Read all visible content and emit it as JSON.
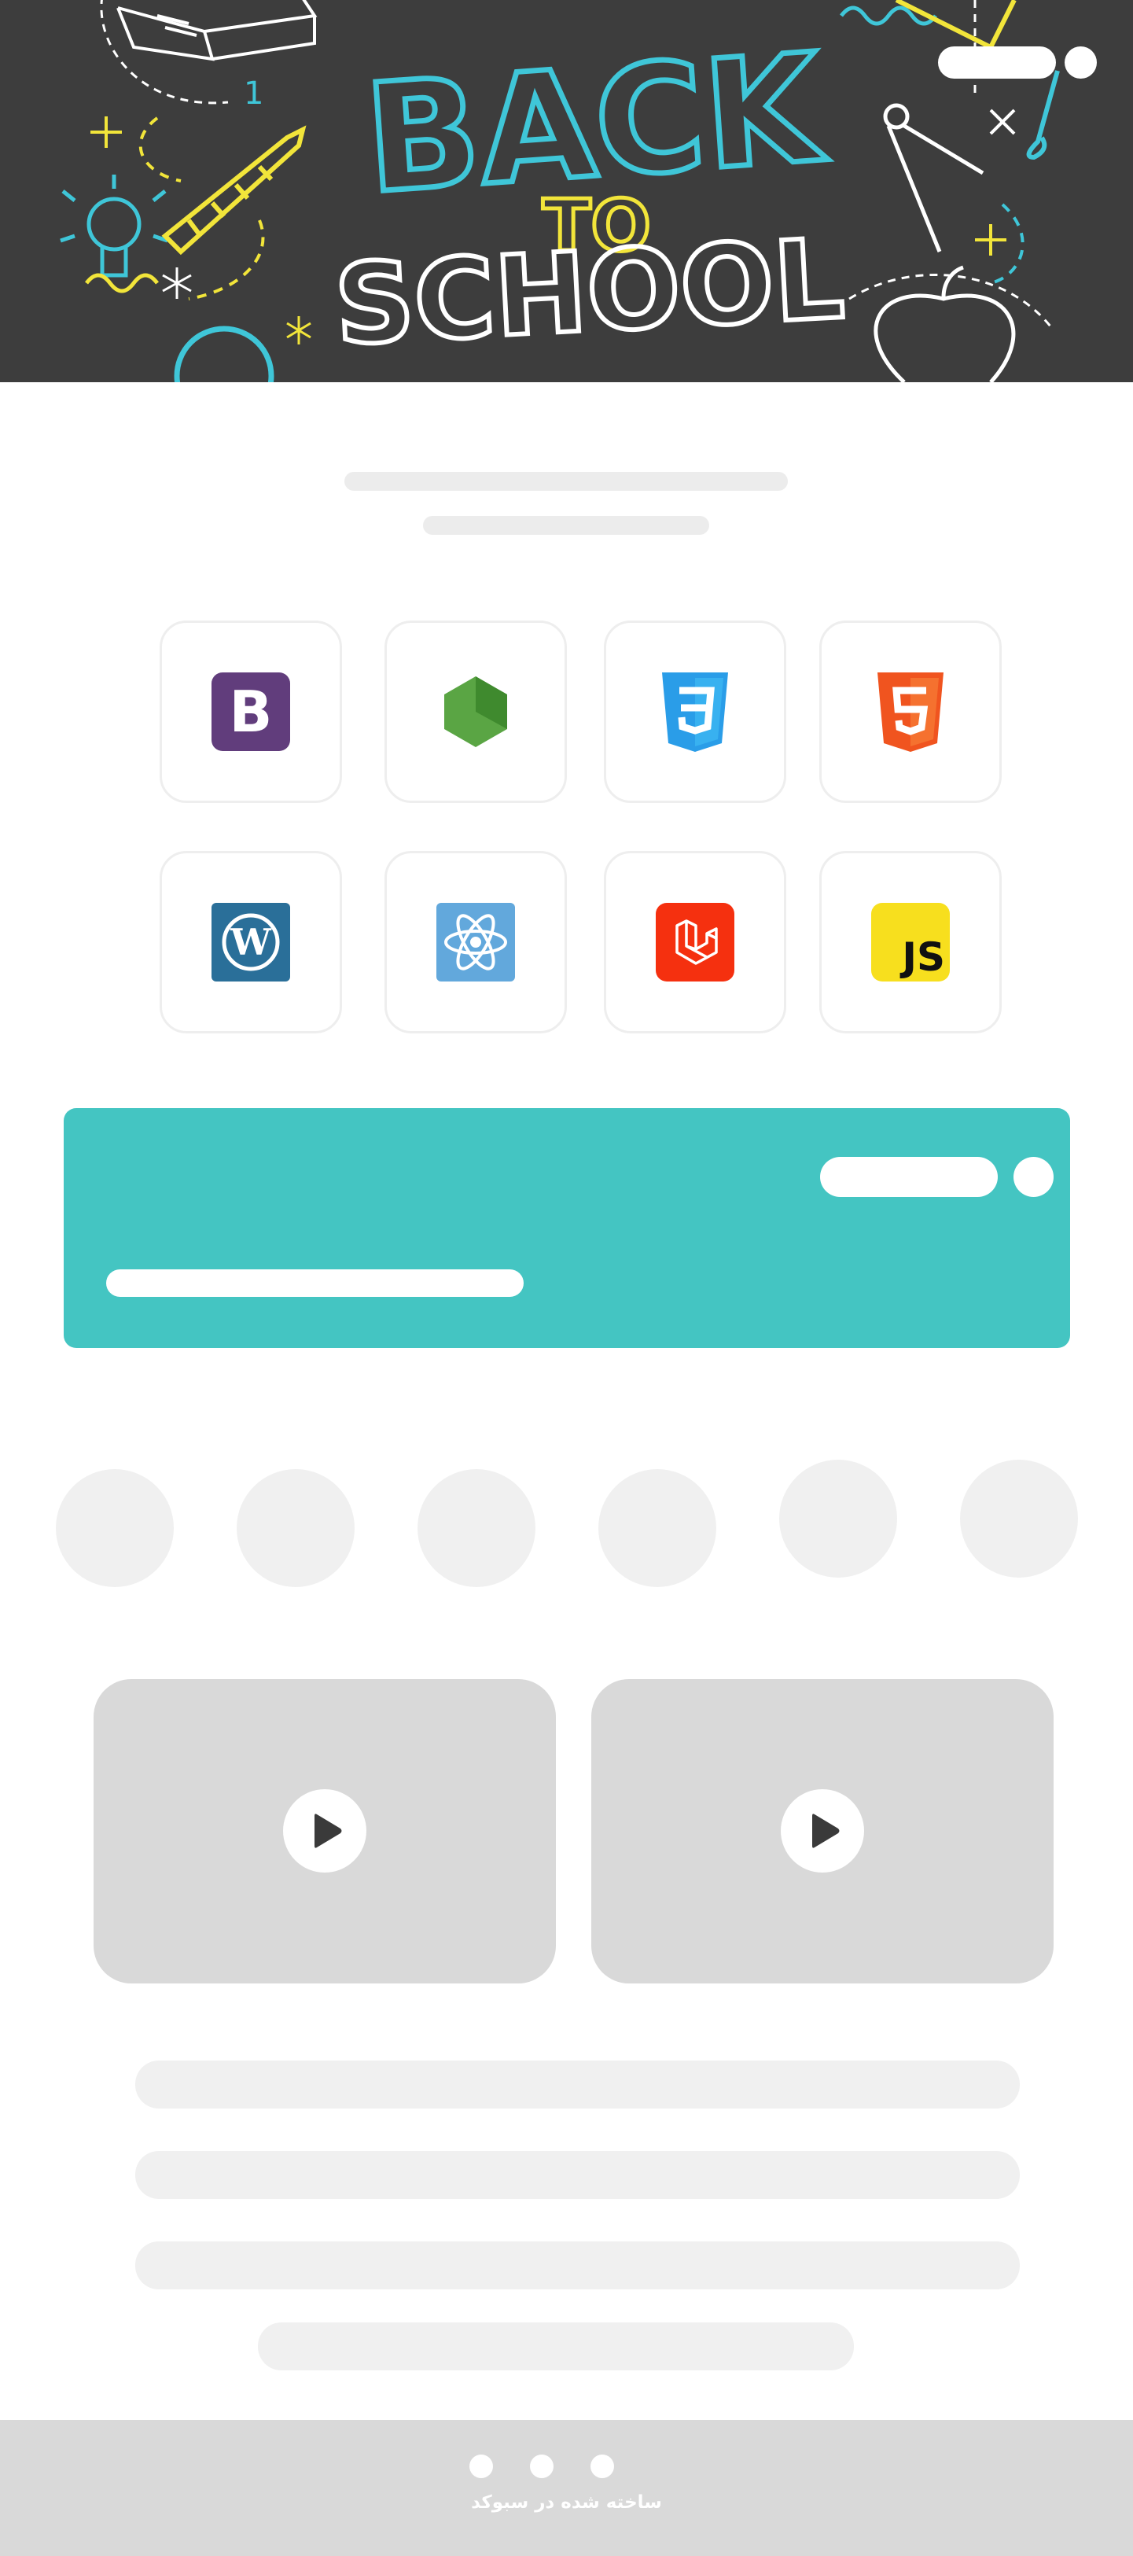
{
  "hero": {
    "headline_back": "BACK",
    "headline_to": "TO",
    "headline_school": "SCHOOL",
    "doodle_number": "1",
    "colors": {
      "background": "#3d3d3d",
      "cyan": "#3fc6d8",
      "yellow": "#f2e53a",
      "white": "#ffffff"
    }
  },
  "tech": [
    {
      "name": "bootstrap",
      "icon": "bootstrap-icon",
      "glyph": "B",
      "color": "#613d7c"
    },
    {
      "name": "nodejs",
      "icon": "nodejs-icon",
      "glyph": "",
      "color": "#5aa544"
    },
    {
      "name": "css3",
      "icon": "css3-icon",
      "glyph": "3",
      "color": "#2a9de8"
    },
    {
      "name": "html5",
      "icon": "html5-icon",
      "glyph": "5",
      "color": "#f0541f"
    },
    {
      "name": "wordpress",
      "icon": "wordpress-icon",
      "glyph": "W",
      "color": "#2a6f99"
    },
    {
      "name": "react",
      "icon": "react-icon",
      "glyph": "",
      "color": "#62a8dc"
    },
    {
      "name": "laravel",
      "icon": "laravel-icon",
      "glyph": "",
      "color": "#f5300f"
    },
    {
      "name": "javascript",
      "icon": "javascript-icon",
      "glyph": "JS",
      "color": "#f7df1e"
    }
  ],
  "banner": {
    "color": "#44c5c2"
  },
  "videos": [
    {
      "icon": "play-icon"
    },
    {
      "icon": "play-icon"
    }
  ],
  "footer": {
    "credit": "ساخته شده در سبوکد",
    "dots": 3
  }
}
